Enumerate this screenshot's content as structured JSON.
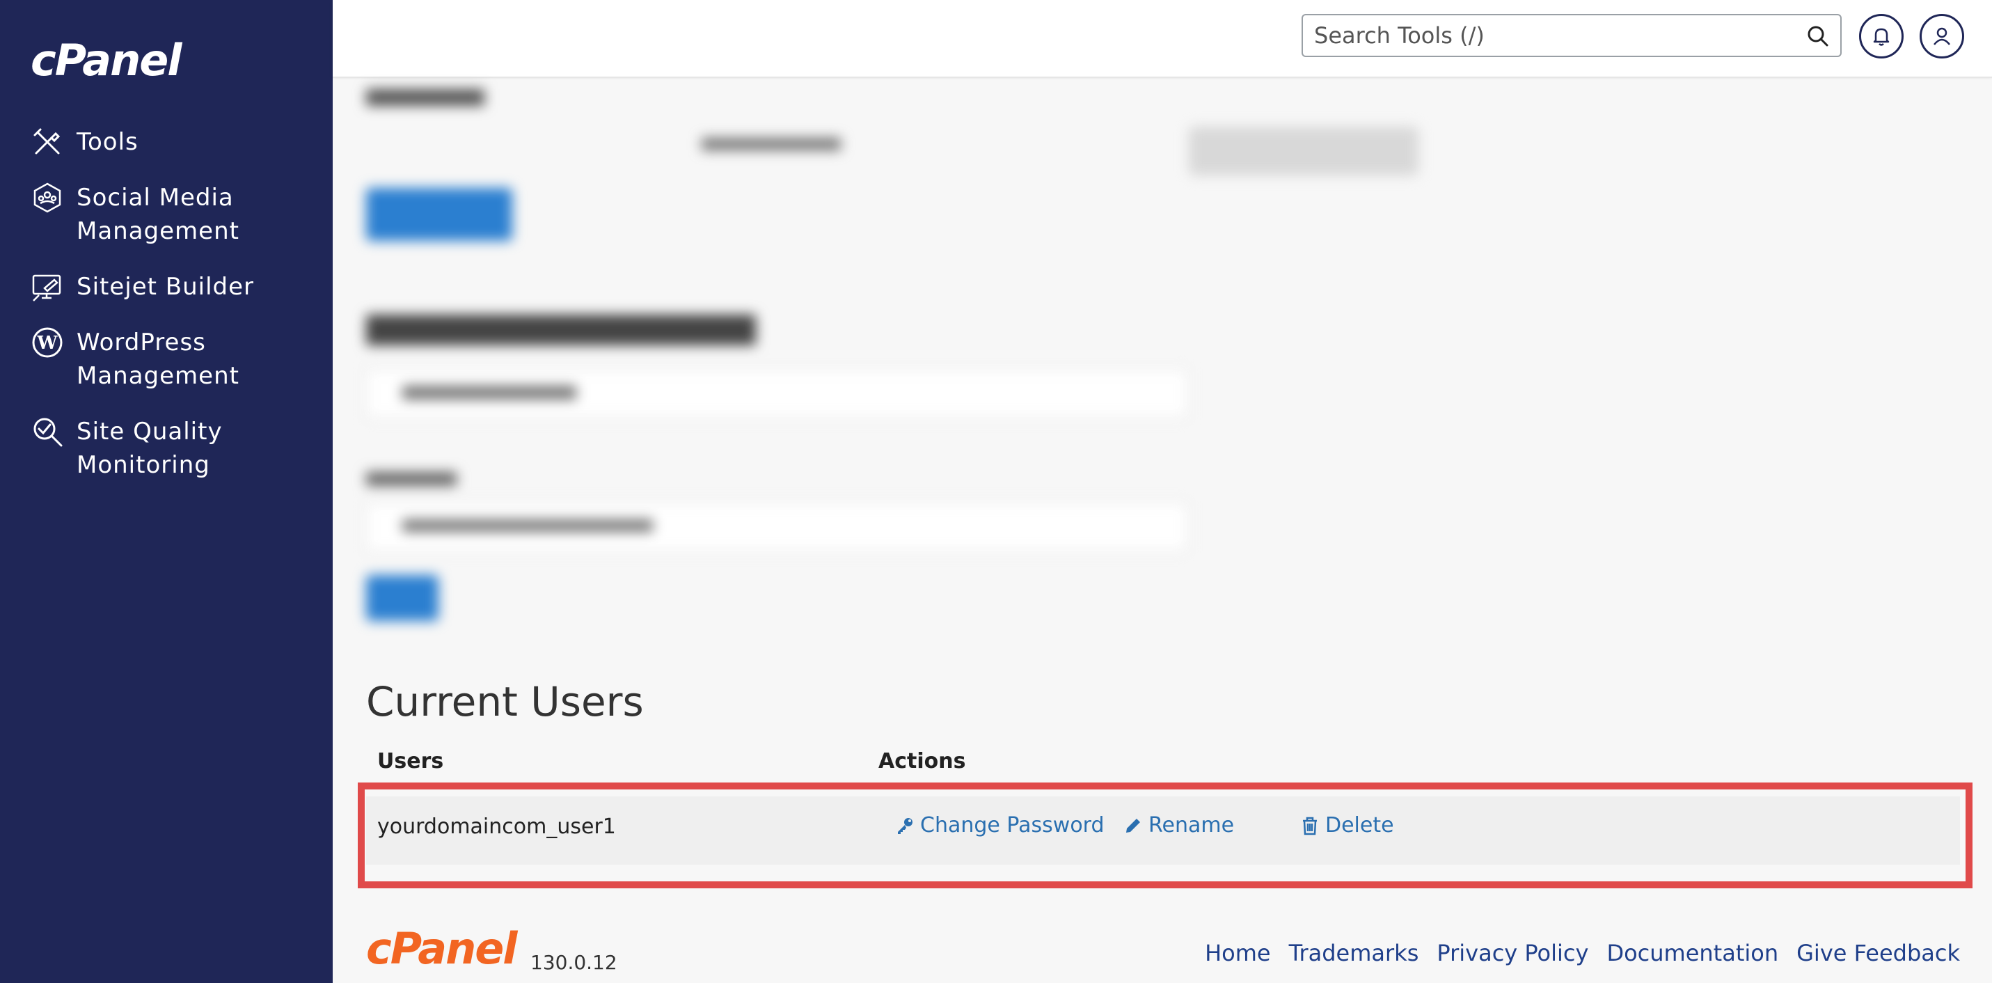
{
  "app": {
    "logo_text": "cPanel",
    "brand_color": "#1f2657",
    "accent_color": "#f26522",
    "link_color": "#2a6fb0",
    "highlight_color": "#e04a4a"
  },
  "sidebar": {
    "items": [
      {
        "label": "Tools",
        "icon": "tools-icon"
      },
      {
        "label": "Social Media\nManagement",
        "icon": "social-media-icon"
      },
      {
        "label": "Sitejet Builder",
        "icon": "sitejet-icon"
      },
      {
        "label": "WordPress\nManagement",
        "icon": "wordpress-icon"
      },
      {
        "label": "Site Quality\nMonitoring",
        "icon": "site-quality-icon"
      }
    ]
  },
  "header": {
    "search_placeholder": "Search Tools (/)",
    "search_icon": "search-icon",
    "notifications_icon": "bell-icon",
    "user_icon": "user-icon"
  },
  "main": {
    "section_title": "Current Users",
    "table": {
      "columns": [
        "Users",
        "Actions"
      ],
      "rows": [
        {
          "user": "yourdomaincom_user1",
          "actions": {
            "change_password": "Change Password",
            "rename": "Rename",
            "delete": "Delete"
          }
        }
      ]
    }
  },
  "footer": {
    "logo_text": "cPanel",
    "version": "130.0.12",
    "links": [
      "Home",
      "Trademarks",
      "Privacy Policy",
      "Documentation",
      "Give Feedback"
    ]
  }
}
